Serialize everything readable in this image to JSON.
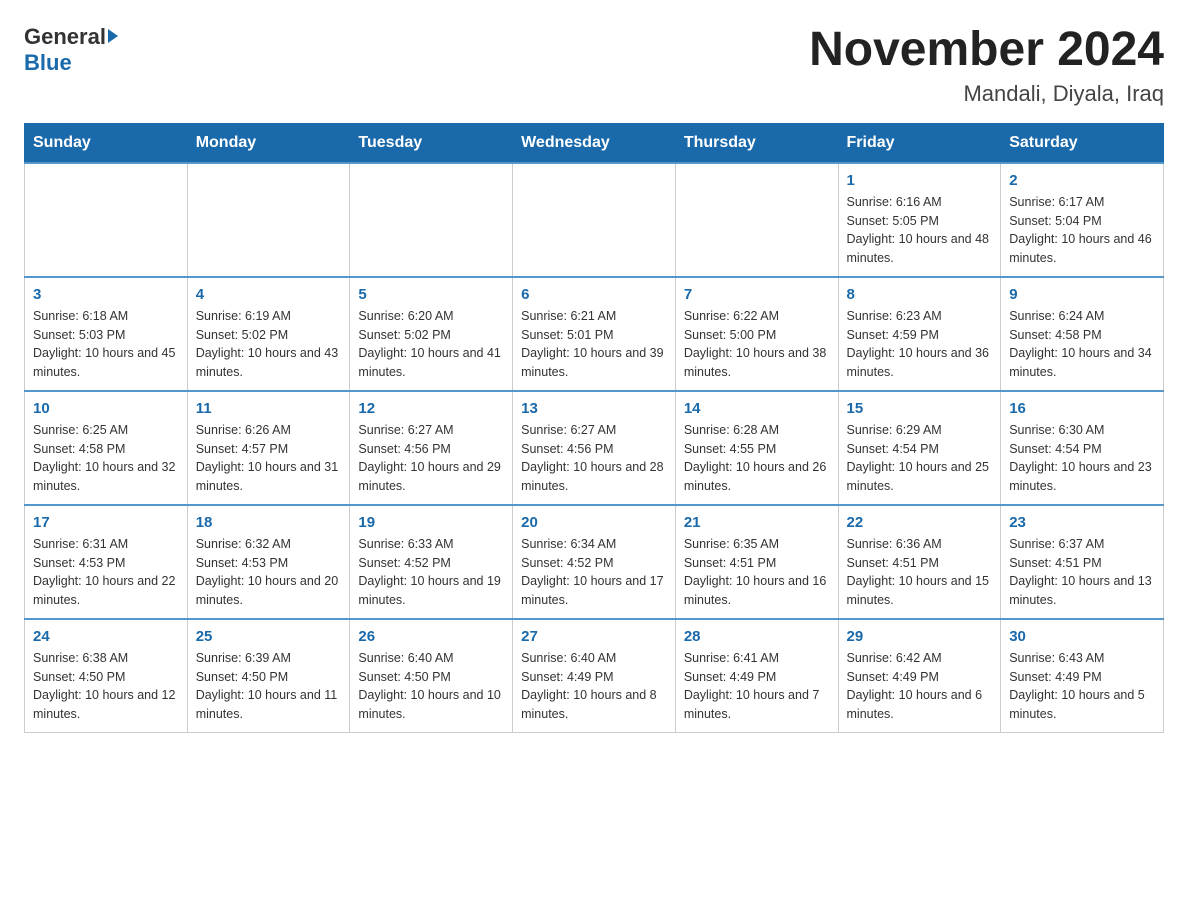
{
  "logo": {
    "general": "General",
    "blue": "Blue"
  },
  "title": "November 2024",
  "location": "Mandali, Diyala, Iraq",
  "weekdays": [
    "Sunday",
    "Monday",
    "Tuesday",
    "Wednesday",
    "Thursday",
    "Friday",
    "Saturday"
  ],
  "weeks": [
    [
      {
        "day": "",
        "info": ""
      },
      {
        "day": "",
        "info": ""
      },
      {
        "day": "",
        "info": ""
      },
      {
        "day": "",
        "info": ""
      },
      {
        "day": "",
        "info": ""
      },
      {
        "day": "1",
        "info": "Sunrise: 6:16 AM\nSunset: 5:05 PM\nDaylight: 10 hours and 48 minutes."
      },
      {
        "day": "2",
        "info": "Sunrise: 6:17 AM\nSunset: 5:04 PM\nDaylight: 10 hours and 46 minutes."
      }
    ],
    [
      {
        "day": "3",
        "info": "Sunrise: 6:18 AM\nSunset: 5:03 PM\nDaylight: 10 hours and 45 minutes."
      },
      {
        "day": "4",
        "info": "Sunrise: 6:19 AM\nSunset: 5:02 PM\nDaylight: 10 hours and 43 minutes."
      },
      {
        "day": "5",
        "info": "Sunrise: 6:20 AM\nSunset: 5:02 PM\nDaylight: 10 hours and 41 minutes."
      },
      {
        "day": "6",
        "info": "Sunrise: 6:21 AM\nSunset: 5:01 PM\nDaylight: 10 hours and 39 minutes."
      },
      {
        "day": "7",
        "info": "Sunrise: 6:22 AM\nSunset: 5:00 PM\nDaylight: 10 hours and 38 minutes."
      },
      {
        "day": "8",
        "info": "Sunrise: 6:23 AM\nSunset: 4:59 PM\nDaylight: 10 hours and 36 minutes."
      },
      {
        "day": "9",
        "info": "Sunrise: 6:24 AM\nSunset: 4:58 PM\nDaylight: 10 hours and 34 minutes."
      }
    ],
    [
      {
        "day": "10",
        "info": "Sunrise: 6:25 AM\nSunset: 4:58 PM\nDaylight: 10 hours and 32 minutes."
      },
      {
        "day": "11",
        "info": "Sunrise: 6:26 AM\nSunset: 4:57 PM\nDaylight: 10 hours and 31 minutes."
      },
      {
        "day": "12",
        "info": "Sunrise: 6:27 AM\nSunset: 4:56 PM\nDaylight: 10 hours and 29 minutes."
      },
      {
        "day": "13",
        "info": "Sunrise: 6:27 AM\nSunset: 4:56 PM\nDaylight: 10 hours and 28 minutes."
      },
      {
        "day": "14",
        "info": "Sunrise: 6:28 AM\nSunset: 4:55 PM\nDaylight: 10 hours and 26 minutes."
      },
      {
        "day": "15",
        "info": "Sunrise: 6:29 AM\nSunset: 4:54 PM\nDaylight: 10 hours and 25 minutes."
      },
      {
        "day": "16",
        "info": "Sunrise: 6:30 AM\nSunset: 4:54 PM\nDaylight: 10 hours and 23 minutes."
      }
    ],
    [
      {
        "day": "17",
        "info": "Sunrise: 6:31 AM\nSunset: 4:53 PM\nDaylight: 10 hours and 22 minutes."
      },
      {
        "day": "18",
        "info": "Sunrise: 6:32 AM\nSunset: 4:53 PM\nDaylight: 10 hours and 20 minutes."
      },
      {
        "day": "19",
        "info": "Sunrise: 6:33 AM\nSunset: 4:52 PM\nDaylight: 10 hours and 19 minutes."
      },
      {
        "day": "20",
        "info": "Sunrise: 6:34 AM\nSunset: 4:52 PM\nDaylight: 10 hours and 17 minutes."
      },
      {
        "day": "21",
        "info": "Sunrise: 6:35 AM\nSunset: 4:51 PM\nDaylight: 10 hours and 16 minutes."
      },
      {
        "day": "22",
        "info": "Sunrise: 6:36 AM\nSunset: 4:51 PM\nDaylight: 10 hours and 15 minutes."
      },
      {
        "day": "23",
        "info": "Sunrise: 6:37 AM\nSunset: 4:51 PM\nDaylight: 10 hours and 13 minutes."
      }
    ],
    [
      {
        "day": "24",
        "info": "Sunrise: 6:38 AM\nSunset: 4:50 PM\nDaylight: 10 hours and 12 minutes."
      },
      {
        "day": "25",
        "info": "Sunrise: 6:39 AM\nSunset: 4:50 PM\nDaylight: 10 hours and 11 minutes."
      },
      {
        "day": "26",
        "info": "Sunrise: 6:40 AM\nSunset: 4:50 PM\nDaylight: 10 hours and 10 minutes."
      },
      {
        "day": "27",
        "info": "Sunrise: 6:40 AM\nSunset: 4:49 PM\nDaylight: 10 hours and 8 minutes."
      },
      {
        "day": "28",
        "info": "Sunrise: 6:41 AM\nSunset: 4:49 PM\nDaylight: 10 hours and 7 minutes."
      },
      {
        "day": "29",
        "info": "Sunrise: 6:42 AM\nSunset: 4:49 PM\nDaylight: 10 hours and 6 minutes."
      },
      {
        "day": "30",
        "info": "Sunrise: 6:43 AM\nSunset: 4:49 PM\nDaylight: 10 hours and 5 minutes."
      }
    ]
  ]
}
